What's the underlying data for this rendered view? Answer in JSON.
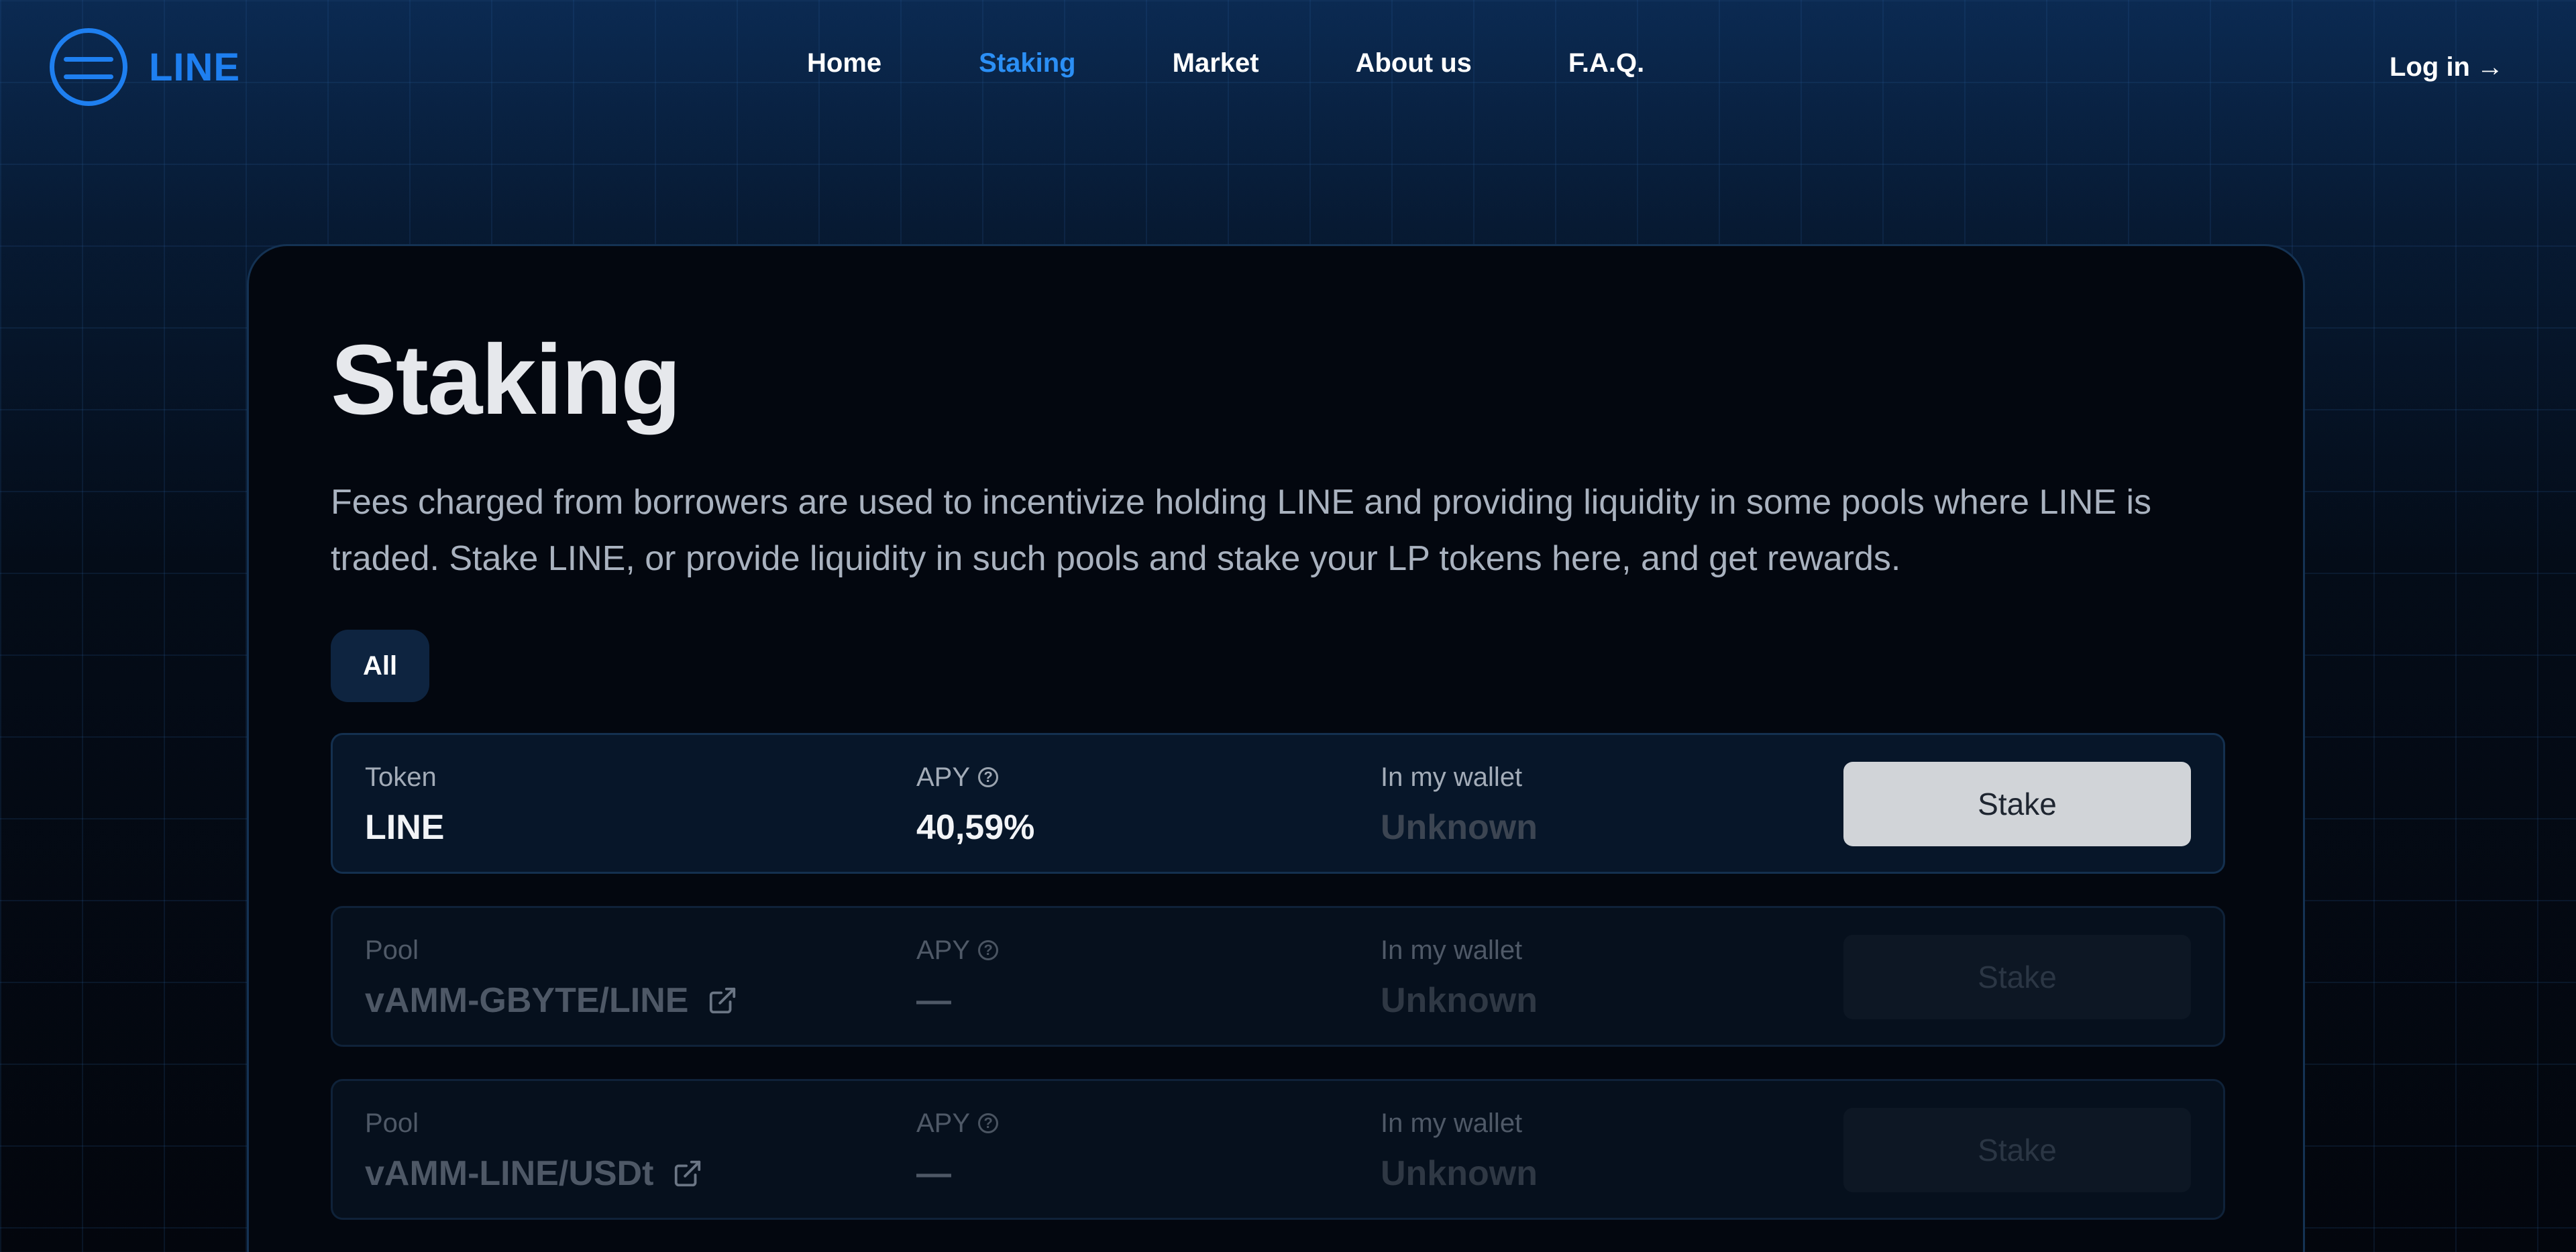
{
  "header": {
    "logo_text": "LINE",
    "nav": [
      "Home",
      "Staking",
      "Market",
      "About us",
      "F.A.Q."
    ],
    "active_nav": "Staking",
    "login_label": "Log in",
    "login_arrow": "→"
  },
  "main": {
    "title": "Staking",
    "description": "Fees charged from borrowers are used to incentivize holding LINE and providing liquidity in some pools where LINE is traded. Stake LINE, or provide liquidity in such pools and stake your LP tokens here, and get rewards.",
    "filter_label": "All",
    "rows": [
      {
        "type_label": "Token",
        "name": "LINE",
        "apy_label": "APY",
        "apy_value": "40,59%",
        "wallet_label": "In my wallet",
        "wallet_value": "Unknown",
        "action_label": "Stake"
      },
      {
        "type_label": "Pool",
        "name": "vAMM-GBYTE/LINE",
        "apy_label": "APY",
        "apy_value": "—",
        "wallet_label": "In my wallet",
        "wallet_value": "Unknown",
        "action_label": "Stake"
      },
      {
        "type_label": "Pool",
        "name": "vAMM-LINE/USDt",
        "apy_label": "APY",
        "apy_value": "—",
        "wallet_label": "In my wallet",
        "wallet_value": "Unknown",
        "action_label": "Stake"
      }
    ]
  },
  "colors": {
    "accent": "#1e7ff0",
    "active_nav": "#2b8ff5",
    "card_bg": "#03070f",
    "button_enabled": "#d1d4d8",
    "button_disabled": "#0d1724"
  },
  "icons": {
    "menu": "menu-icon",
    "help": "help-circle-icon",
    "external_link": "external-link-icon"
  }
}
